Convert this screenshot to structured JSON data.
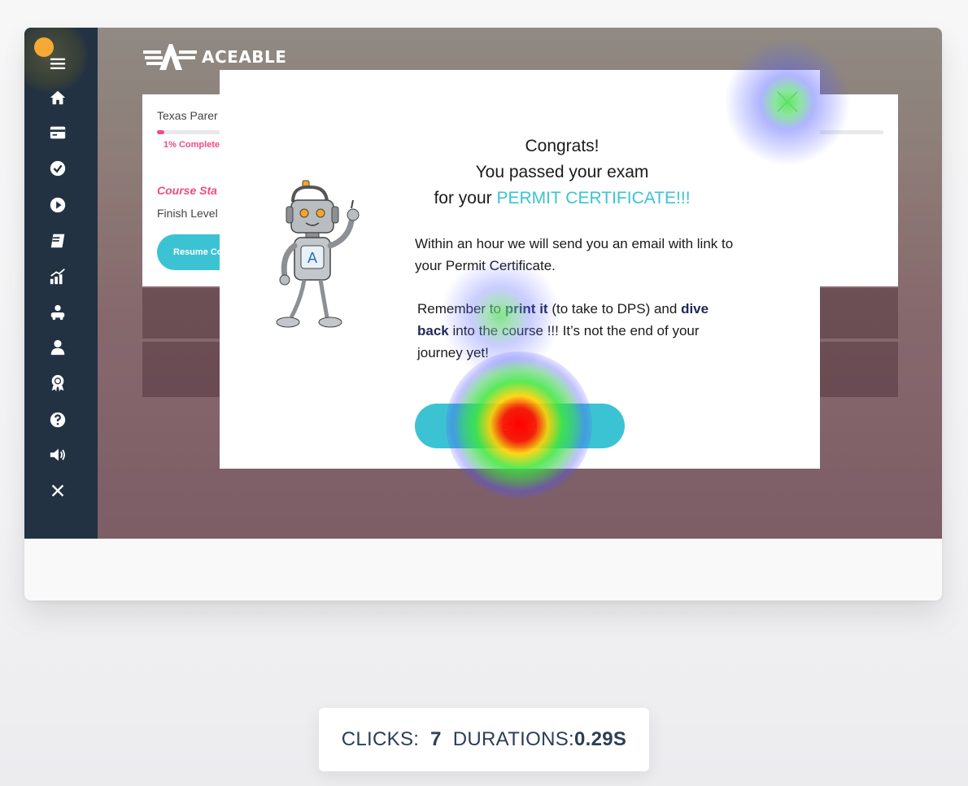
{
  "brand": {
    "logo_text": "ACEABLE"
  },
  "sidebar": {
    "items": [
      {
        "icon": "menu-icon"
      },
      {
        "icon": "home-icon"
      },
      {
        "icon": "credit-card-icon"
      },
      {
        "icon": "check-circle-icon"
      },
      {
        "icon": "play-circle-icon"
      },
      {
        "icon": "book-icon"
      },
      {
        "icon": "chart-icon"
      },
      {
        "icon": "driver-icon"
      },
      {
        "icon": "user-icon"
      },
      {
        "icon": "award-icon"
      },
      {
        "icon": "help-icon"
      },
      {
        "icon": "volume-icon"
      },
      {
        "icon": "close-icon"
      }
    ]
  },
  "dashboard": {
    "title": "Texas Parer",
    "progress_label": "1% Complete",
    "progress": 0.01,
    "course_status": "Course Sta",
    "finish_text": "Finish Level",
    "resume_label": "Resume Co"
  },
  "modal": {
    "line1": "Congrats!",
    "line2": "You passed your exam",
    "line3_prefix": "for your ",
    "line3_highlight": "PERMIT CERTIFICATE!!!",
    "para1": "Within an hour we will send you an email with link to your Permit Certificate.",
    "para2_a": "Remember to ",
    "para2_b": "print it",
    "para2_c": " (to take to DPS) and ",
    "para2_d": "dive back",
    "para2_e": " into the course !!! It’s not the end of your journey yet!",
    "button_label": "Got it!"
  },
  "stats": {
    "clicks_label": "CLICKS:",
    "clicks_value": "7",
    "duration_label": "DURATIONS:",
    "duration_value": "0.29S"
  },
  "colors": {
    "sidebar": "#223242",
    "accent": "#3cc3d3",
    "pink": "#f04b86",
    "menu_dot": "#f7a936"
  }
}
